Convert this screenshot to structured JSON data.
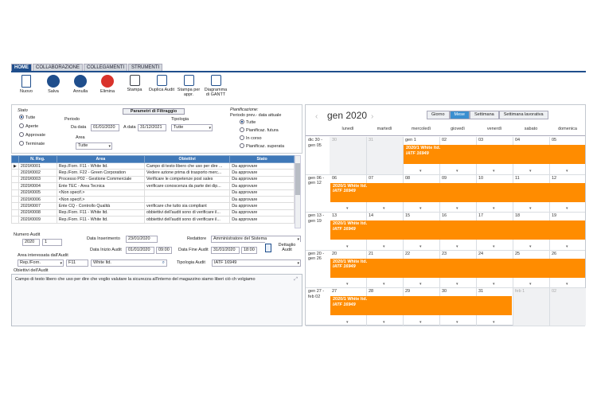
{
  "tabs": [
    "HOME",
    "COLLABORAZIONE",
    "COLLEGAMENTI",
    "STRUMENTI"
  ],
  "toolbar": [
    {
      "label": "Nuovo",
      "icon": "new-doc-icon"
    },
    {
      "label": "Salva",
      "icon": "save-check-icon"
    },
    {
      "label": "Annulla",
      "icon": "undo-icon"
    },
    {
      "label": "Elimina",
      "icon": "delete-icon"
    },
    {
      "label": "Stampa",
      "icon": "print-icon"
    },
    {
      "label": "Duplica Audit",
      "icon": "duplicate-icon"
    },
    {
      "label": "Stampa per appr.",
      "icon": "print-approve-icon"
    },
    {
      "label": "Diagramma di GANTT",
      "icon": "gantt-icon"
    }
  ],
  "filter": {
    "stato_title": "Stato",
    "stato_options": [
      "Tutte",
      "Aperte",
      "Approvate",
      "Terminate"
    ],
    "param_button": "Parametri di Filtraggio",
    "periodo_label": "Periodo",
    "da_label": "Da data",
    "da_value": "01/01/2020",
    "a_label": "A data",
    "a_value": "31/12/2021",
    "tipologia_label": "Tipologia",
    "tipologia_value": "Tutte",
    "area_label": "Area",
    "area_value": "Tutte",
    "pian_title": "Pianificazione:",
    "pian_sub": "Periodo prev.- data attuale",
    "pian_options": [
      "Tutte",
      "Pianificaz. futura",
      "In corso",
      "Pianificaz. superata"
    ]
  },
  "grid": {
    "headers": [
      "N. Reg.",
      "Area",
      "Obiettivi",
      "Stato"
    ],
    "rows": [
      [
        "2020/0001",
        "Rep./Forn. F11 - White ltd.",
        "Campo di testo libero che uso per dire ...",
        "Da approvare"
      ],
      [
        "2020/0002",
        "Rep./Forn. F22 - Green Corporation",
        "Vedere azione prima di trasporto merc...",
        "Da approvare"
      ],
      [
        "2020/0003",
        "Processo P02 - Gestione Commerciale",
        "Verificare le competenze post sales",
        "Da approvare"
      ],
      [
        "2020/0004",
        "Ente TEC - Area Tecnica",
        "verificare conoscenza da parte dei dip...",
        "Da approvare"
      ],
      [
        "2020/0005",
        "<Non specif.>",
        "",
        "Da approvare"
      ],
      [
        "2020/0006",
        "<Non specif.>",
        "",
        "Da approvare"
      ],
      [
        "2020/0007",
        "Ente CQ - Controllo Qualità",
        "verificare che tutto sia compliant",
        "Da approvare"
      ],
      [
        "2020/0008",
        "Rep./Forn. F11 - White ltd.",
        "obbiettivi dell'audit sono di verificare il...",
        "Da approvare"
      ],
      [
        "2020/0009",
        "Rep./Forn. F11 - White ltd.",
        "obbiettivi dell'audit sono di verificare il...",
        "Da approvare"
      ]
    ]
  },
  "detail": {
    "numero_label": "Numero Audit",
    "anno": "2020",
    "numero": "1",
    "ins_label": "Data Inserimento",
    "ins_value": "23/01/2020",
    "red_label": "Redattore",
    "red_value": "Amministratore del Sistema",
    "inizio_label": "Data Inizio Audit",
    "inizio_value": "01/01/2020",
    "inizio_ora": "09:00",
    "fine_label": "Data Fine Audit",
    "fine_value": "31/01/2020",
    "fine_ora": "18:00",
    "dettaglio_button": "Dettaglio Audit",
    "area_label": "Area interessata dall'Audit",
    "area_type": "Rep./Forn.",
    "area_code": "F11",
    "area_name": "White ltd.",
    "tip_label": "Tipologia Audit",
    "tip_value": "IATF 16949",
    "obj_label": "Obiettivi dell'Audit",
    "obj_text": "Campo di testo libero che uso per dire che voglio valutare la sicurezza all'interno del magazzino siamo liberi ciò ch volgiamo"
  },
  "calendar": {
    "month": "gen 2020",
    "views": [
      "Giorno",
      "Mese",
      "Settimana",
      "Settimana lavorativa"
    ],
    "active_view": "Mese",
    "days": [
      "lunedì",
      "martedì",
      "mercoledì",
      "giovedì",
      "venerdì",
      "sabato",
      "domenica"
    ],
    "weeks": [
      {
        "label": "dic 30 - gen 05",
        "nums": [
          "30",
          "31",
          "gen 1",
          "02",
          "03",
          "04",
          "05"
        ]
      },
      {
        "label": "gen 06 - gen 12",
        "nums": [
          "06",
          "07",
          "08",
          "09",
          "10",
          "11",
          "12"
        ]
      },
      {
        "label": "gen 13 - gen 19",
        "nums": [
          "13",
          "14",
          "15",
          "16",
          "17",
          "18",
          "19"
        ]
      },
      {
        "label": "gen 20 - gen 26",
        "nums": [
          "20",
          "21",
          "22",
          "23",
          "24",
          "25",
          "26"
        ]
      },
      {
        "label": "gen 27 - feb 02",
        "nums": [
          "27",
          "28",
          "29",
          "30",
          "31",
          "feb 1",
          "02"
        ]
      }
    ],
    "event_title": "2020/1 White ltd.",
    "event_sub": "IATF 16949",
    "event_color": "#ff8c00"
  }
}
